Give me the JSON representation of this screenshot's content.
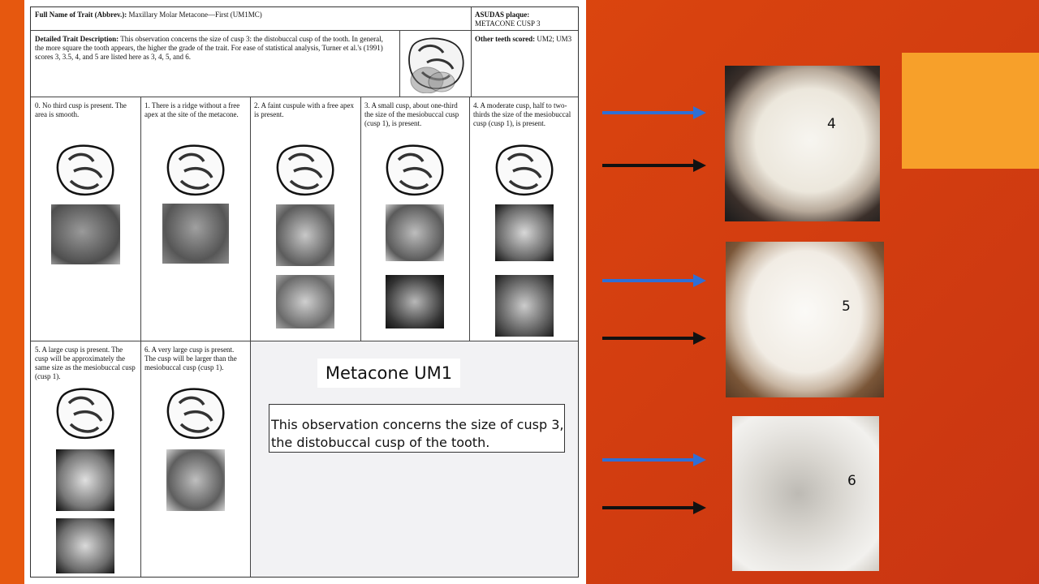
{
  "header": {
    "trait_label": "Full Name of Trait (Abbrev.):",
    "trait_value": " Maxillary Molar Metacone—First (UM1MC)",
    "plaque_label": "ASUDAS plaque:",
    "plaque_value": "METACONE CUSP 3"
  },
  "description": {
    "label": "Detailed Trait Description:",
    "text": " This observation concerns the size of cusp 3: the distobuccal cusp of the tooth. In general, the more square the tooth appears, the higher the grade of the trait. For ease of statistical analysis, Turner et al.'s (1991) scores 3, 3.5, 4, and 5 are listed here as 3, 4, 5, and 6.",
    "other_label": "Other teeth scored:",
    "other_value": " UM2; UM3"
  },
  "grades": [
    {
      "text": "0. No third cusp is present. The area is smooth."
    },
    {
      "text": "1. There is a ridge without a free apex at the site of the metacone."
    },
    {
      "text": "2. A faint cuspule with a free apex is present."
    },
    {
      "text": "3. A small cusp, about one-third the size of the mesiobuccal cusp (cusp 1), is present."
    },
    {
      "text": "4. A moderate cusp, half to two-thirds the size of the mesiobuccal cusp (cusp 1), is present."
    },
    {
      "text": "5. A large cusp is present. The cusp will be approximately the same size as the mesiobuccal cusp (cusp 1)."
    },
    {
      "text": "6. A very large cusp is present. The cusp will be larger than the mesiobuccal cusp (cusp 1)."
    }
  ],
  "overlay": {
    "title": "Metacone UM1",
    "text": "This observation concerns the size of cusp 3, the distobuccal cusp of the tooth."
  },
  "right_panel": {
    "labels": [
      "4",
      "5",
      "6"
    ]
  },
  "colors": {
    "background": "#d8420f",
    "blue_arrow": "#2f6fd6",
    "black_arrow": "#111111",
    "accent_box": "#f7a02a"
  }
}
